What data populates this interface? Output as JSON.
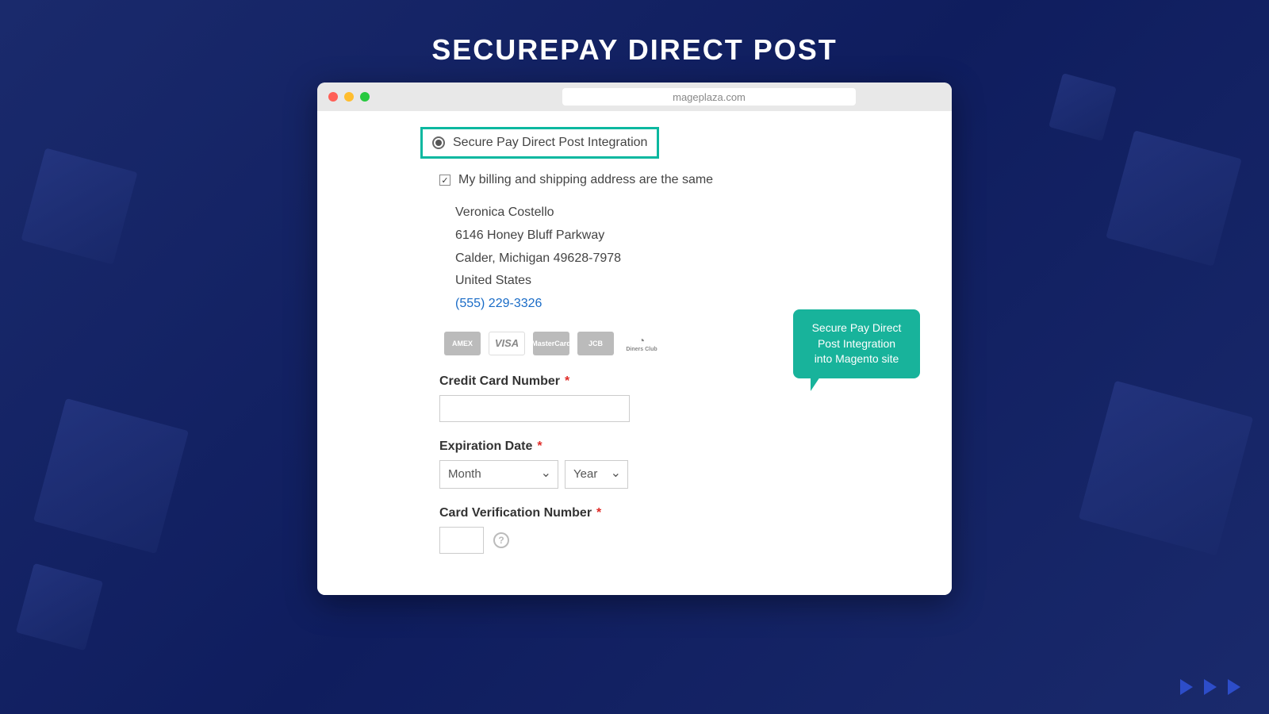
{
  "page_title": "SECUREPAY DIRECT POST",
  "browser_url": "mageplaza.com",
  "payment_method_label": "Secure Pay Direct Post Integration",
  "billing_checkbox_label": "My billing and shipping address are the same",
  "address": {
    "name": "Veronica Costello",
    "street": "6146 Honey Bluff Parkway",
    "city_state_zip": "Calder, Michigan 49628-7978",
    "country": "United States",
    "phone": "(555) 229-3326"
  },
  "card_brands": {
    "amex": "AMEX",
    "visa": "VISA",
    "mastercard": "MasterCard",
    "jcb": "JCB",
    "diners": "Diners Club"
  },
  "form": {
    "cc_label": "Credit Card Number",
    "exp_label": "Expiration Date",
    "month_placeholder": "Month",
    "year_placeholder": "Year",
    "cvv_label": "Card Verification Number"
  },
  "callout_text": "Secure Pay Direct Post Integration into Magento site"
}
